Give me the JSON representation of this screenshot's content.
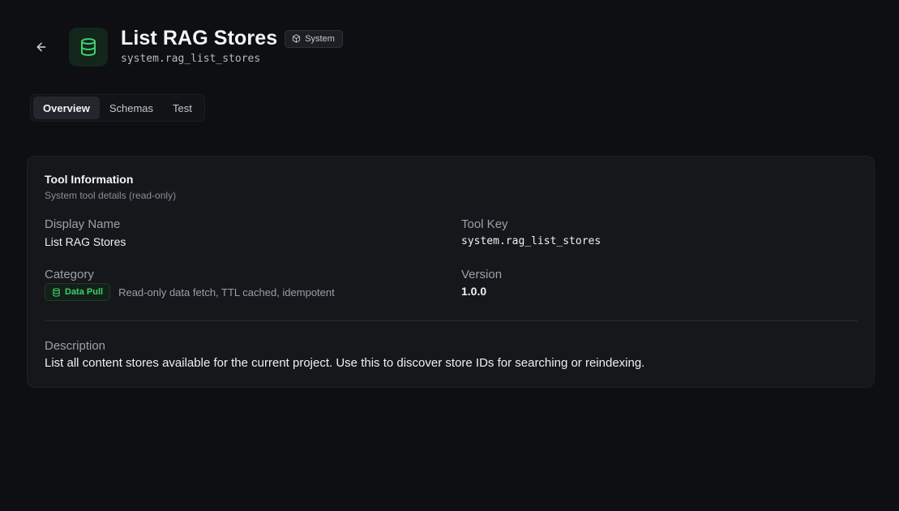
{
  "header": {
    "back_icon": "arrow-left-icon",
    "tool_icon": "database-icon",
    "title": "List RAG Stores",
    "badge": {
      "icon": "cube-icon",
      "label": "System"
    },
    "subtitle": "system.rag_list_stores"
  },
  "tabs": [
    {
      "label": "Overview",
      "active": true
    },
    {
      "label": "Schemas",
      "active": false
    },
    {
      "label": "Test",
      "active": false
    }
  ],
  "card": {
    "title": "Tool Information",
    "subtitle": "System tool details (read-only)",
    "display_name": {
      "label": "Display Name",
      "value": "List RAG Stores"
    },
    "tool_key": {
      "label": "Tool Key",
      "value": "system.rag_list_stores"
    },
    "category": {
      "label": "Category",
      "badge": {
        "icon": "database-icon",
        "label": "Data Pull"
      },
      "description": "Read-only data fetch, TTL cached, idempotent"
    },
    "version": {
      "label": "Version",
      "value": "1.0.0"
    },
    "description": {
      "label": "Description",
      "value": "List all content stores available for the current project. Use this to discover store IDs for searching or reindexing."
    }
  },
  "colors": {
    "background": "#0e0f12",
    "card": "#15171b",
    "accent_green": "#3ecf6e"
  }
}
